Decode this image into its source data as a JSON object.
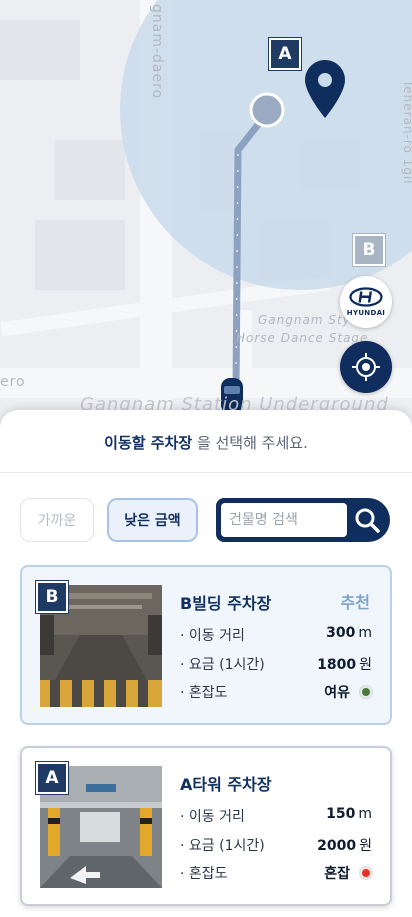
{
  "map": {
    "road_labels": [
      "gnam-daero",
      "Gangnam Style",
      "Horse Dance Stage",
      "Gangnam Station Underground",
      "ero",
      "Teheran-ro 1gil"
    ],
    "markers": {
      "destination": "A",
      "secondary": "B"
    },
    "brand_button": {
      "label": "HYUNDAI",
      "icon": "hyundai-logo-icon"
    },
    "locate_button": {
      "icon": "crosshair-icon"
    },
    "colors": {
      "route": "#8aa0bf",
      "radius": "#c9dcec",
      "pin": "#0f2e5e"
    }
  },
  "sheet": {
    "prompt_bold": "이동할 주차장",
    "prompt_rest": " 을 선택해 주세요.",
    "filters": {
      "near": "가까운",
      "cheap": "낮은 금액"
    },
    "search": {
      "placeholder": "건물명 검색",
      "icon": "search-icon"
    },
    "lots": [
      {
        "badge": "B",
        "name": "B빌딩 주차장",
        "tag": "추천",
        "rows": [
          {
            "label": "· 이동 거리",
            "value": "300",
            "unit": "m"
          },
          {
            "label": "· 요금 (1시간)",
            "value": "1800",
            "unit": "원"
          },
          {
            "label": "· 혼잡도",
            "value": "여유",
            "status_color": "#4a7a3a"
          }
        ]
      },
      {
        "badge": "A",
        "name": "A타워 주차장",
        "tag": "",
        "rows": [
          {
            "label": "· 이동 거리",
            "value": "150",
            "unit": "m"
          },
          {
            "label": "· 요금 (1시간)",
            "value": "2000",
            "unit": "원"
          },
          {
            "label": "· 혼잡도",
            "value": "혼잡",
            "status_color": "#e53222"
          }
        ]
      }
    ]
  }
}
